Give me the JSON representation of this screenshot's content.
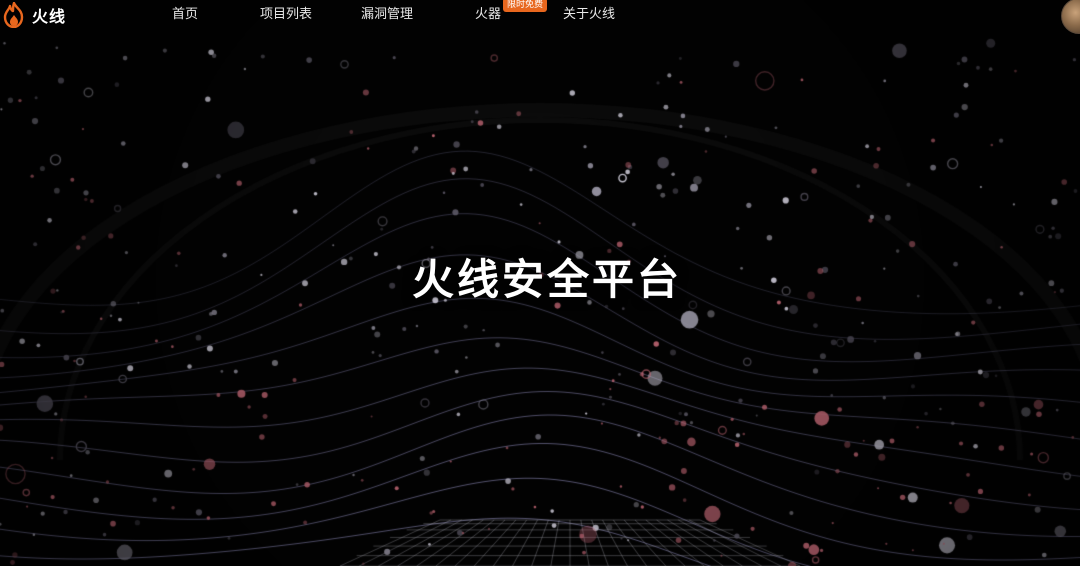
{
  "brand": {
    "name": "火线",
    "accent_color": "#e8671e",
    "logo_icon": "flame-logo-icon"
  },
  "nav": {
    "items": [
      {
        "label": "首页"
      },
      {
        "label": "项目列表"
      },
      {
        "label": "漏洞管理"
      },
      {
        "label": "火器",
        "badge": "限时免费"
      },
      {
        "label": "关于火线"
      }
    ]
  },
  "user": {
    "avatar_icon": "user-avatar-icon"
  },
  "hero": {
    "title": "火线安全平台",
    "background": "#020202",
    "particle_colors": [
      "#9a97a6",
      "#c76a78",
      "#d9d6e4",
      "#5e5a68"
    ],
    "wave_color": "#8d8ab8"
  }
}
